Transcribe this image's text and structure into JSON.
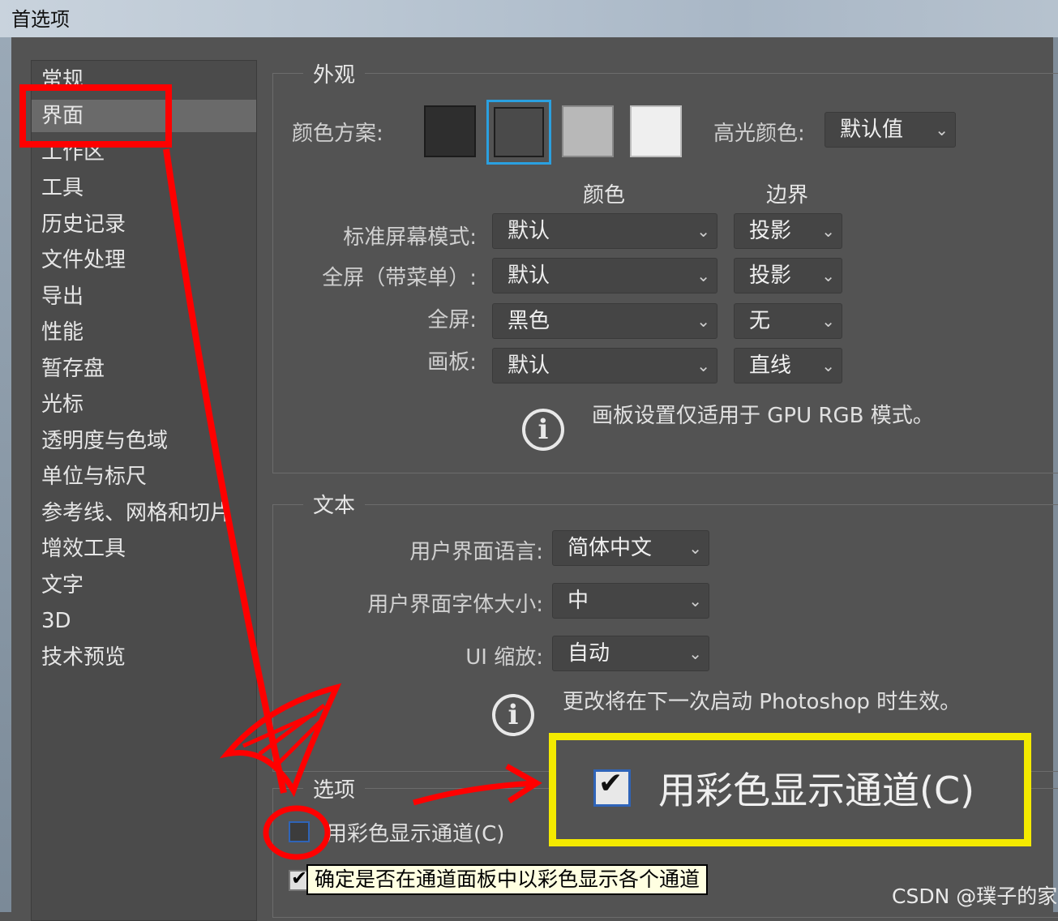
{
  "window": {
    "title": "首选项"
  },
  "sidebar": {
    "items": [
      {
        "label": "常规"
      },
      {
        "label": "界面"
      },
      {
        "label": "工作区"
      },
      {
        "label": "工具"
      },
      {
        "label": "历史记录"
      },
      {
        "label": "文件处理"
      },
      {
        "label": "导出"
      },
      {
        "label": "性能"
      },
      {
        "label": "暂存盘"
      },
      {
        "label": "光标"
      },
      {
        "label": "透明度与色域"
      },
      {
        "label": "单位与标尺"
      },
      {
        "label": "参考线、网格和切片"
      },
      {
        "label": "增效工具"
      },
      {
        "label": "文字"
      },
      {
        "label": "3D"
      },
      {
        "label": "技术预览"
      }
    ],
    "selected": "界面"
  },
  "appearance": {
    "legend": "外观",
    "color_scheme_label": "颜色方案:",
    "swatches": [
      "#2e2e2e",
      "#535353",
      "#b8b8b8",
      "#efefef"
    ],
    "selected_swatch_index": 1,
    "highlight_label": "高光颜色:",
    "highlight_value": "默认值",
    "col_color": "颜色",
    "col_border": "边界",
    "rows": [
      {
        "label": "标准屏幕模式:",
        "color": "默认",
        "border": "投影"
      },
      {
        "label": "全屏（带菜单）:",
        "color": "默认",
        "border": "投影"
      },
      {
        "label": "全屏:",
        "color": "黑色",
        "border": "无"
      },
      {
        "label": "画板:",
        "color": "默认",
        "border": "直线"
      }
    ],
    "note": "画板设置仅适用于 GPU RGB 模式。"
  },
  "text": {
    "legend": "文本",
    "lang_label": "用户界面语言:",
    "lang_value": "简体中文",
    "font_label": "用户界面字体大小:",
    "font_value": "中",
    "scale_label": "UI 缩放:",
    "scale_value": "自动",
    "note": "更改将在下一次启动 Photoshop 时生效。"
  },
  "options": {
    "legend": "选项",
    "channel_color_label": "用彩色显示通道(C)",
    "channel_color_checked": false,
    "tooltip": "确定是否在通道面板中以彩色显示各个通道"
  },
  "callout": {
    "label": "用彩色显示通道(C)",
    "checked": true
  },
  "watermark": "CSDN @璞子的家",
  "colors": {
    "accent": "#2aa0e0",
    "annotation_red": "#ff0000",
    "annotation_yellow": "#f4ea00"
  }
}
